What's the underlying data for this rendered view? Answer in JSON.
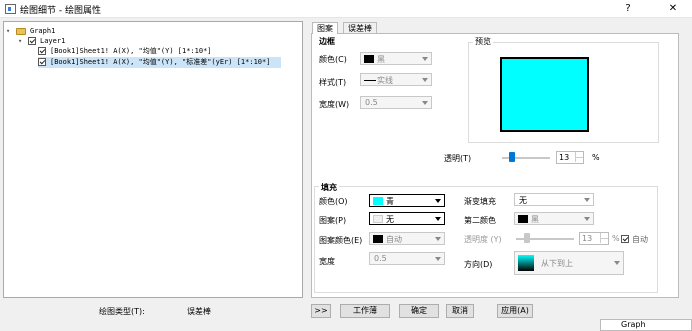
{
  "window": {
    "title": "绘图细节 - 绘图属性",
    "help_label": "?",
    "close_label": "✕"
  },
  "tree": {
    "root": "Graph1",
    "layer": "Layer1",
    "plots": [
      "[Book1]Sheet1! A(X), \"均值\"(Y) [1*:10*]",
      "[Book1]Sheet1! A(X), \"均值\"(Y), \"标准差\"(yEr) [1*:10*]"
    ]
  },
  "tabs": [
    "图案",
    "误差棒"
  ],
  "border": {
    "group_label": "边框",
    "color_label": "颜色(C)",
    "color_value": "黑",
    "color_hex": "#000000",
    "style_label": "样式(T)",
    "style_value": "实线",
    "width_label": "宽度(W)",
    "width_value": "0.5"
  },
  "preview": {
    "label": "预览",
    "fill_hex": "#00ffff"
  },
  "transparency": {
    "label": "透明(T)",
    "value": "13",
    "unit": "%",
    "level": 0.13
  },
  "fill": {
    "group_label": "填充",
    "color_label": "颜色(O)",
    "color_value": "青",
    "color_hex": "#00ffff",
    "pattern_label": "图案(P)",
    "pattern_value": "无",
    "pattern_color_label": "图案颜色(E)",
    "pattern_color_value": "自动",
    "pattern_width_label": "宽度",
    "pattern_width_value": "0.5",
    "gradient_label": "渐变填充",
    "gradient_value": "无",
    "second_color_label": "第二颜色",
    "second_color_value": "黑",
    "gradient_transparency_label": "透明度 (Y)",
    "gradient_transparency_value": "13",
    "gradient_transparency_unit": "%",
    "auto_label": "自动",
    "direction_label": "方向(D)",
    "direction_value": "从下到上"
  },
  "footer": {
    "plot_type_label": "绘图类型(T):",
    "plot_type_value": "误差棒",
    "expand_label": ">>",
    "workbook_label": "工作薄",
    "ok_label": "确定",
    "cancel_label": "取消",
    "apply_label": "应用(A)"
  },
  "taskbar": {
    "graph_tag": "Graph"
  }
}
